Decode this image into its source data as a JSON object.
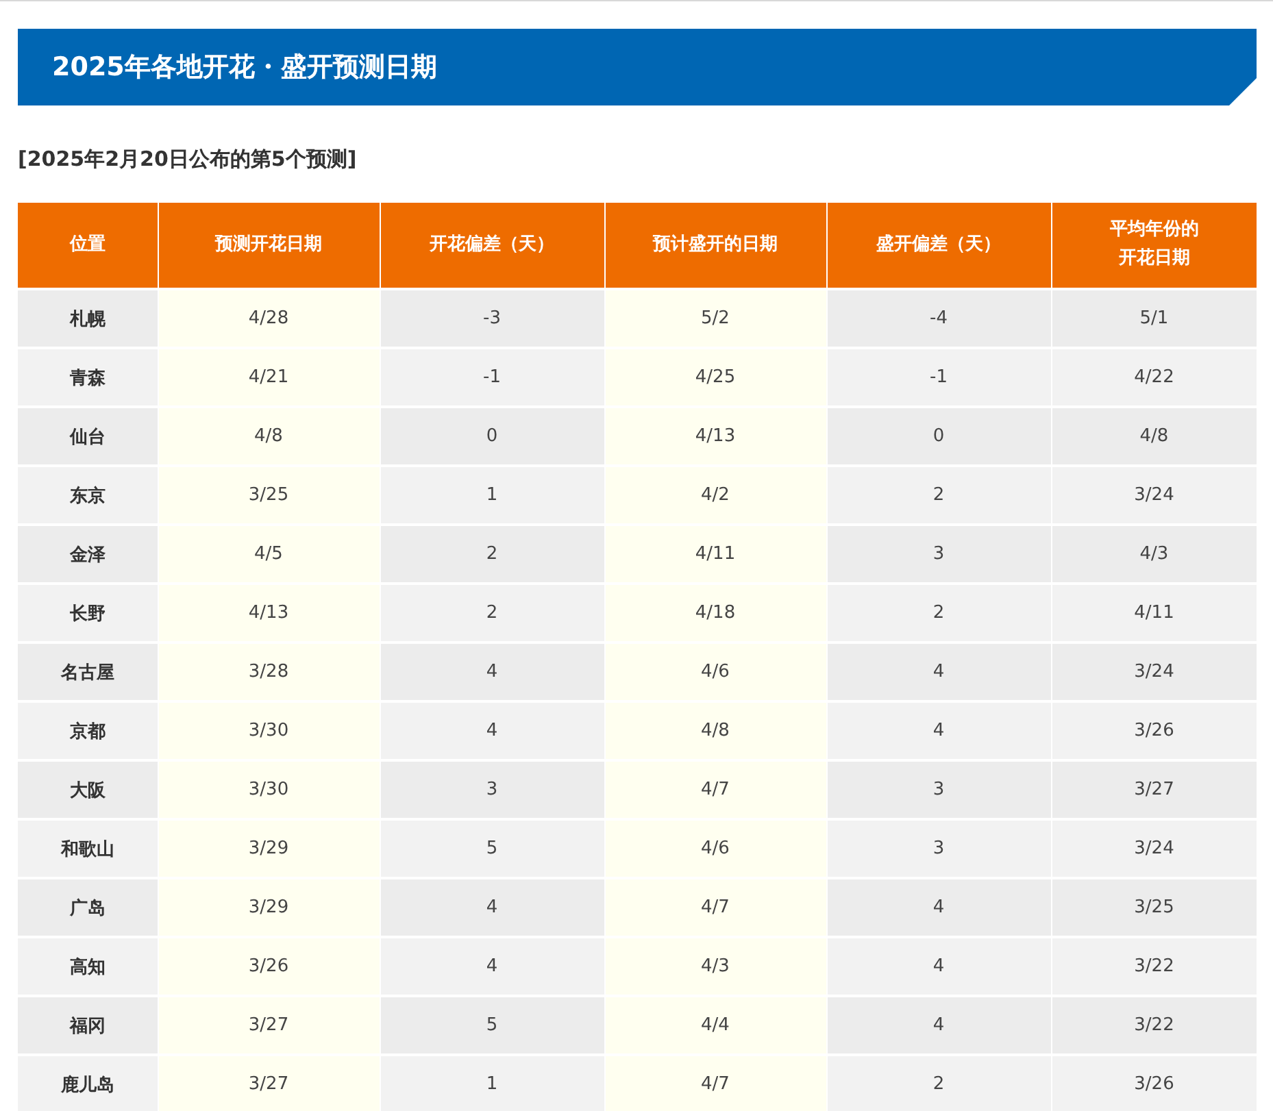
{
  "banner": {
    "title": "2025年各地开花・盛开预测日期"
  },
  "subtitle": "[2025年2月20日公布的第5个预测]",
  "table": {
    "columns": [
      "位置",
      "预测开花日期",
      "开花偏差（天）",
      "预计盛开的日期",
      "盛开偏差（天）",
      "平均年份的开花日期"
    ],
    "rows": [
      [
        "札幌",
        "4/28",
        "-3",
        "5/2",
        "-4",
        "5/1"
      ],
      [
        "青森",
        "4/21",
        "-1",
        "4/25",
        "-1",
        "4/22"
      ],
      [
        "仙台",
        "4/8",
        "0",
        "4/13",
        "0",
        "4/8"
      ],
      [
        "东京",
        "3/25",
        "1",
        "4/2",
        "2",
        "3/24"
      ],
      [
        "金泽",
        "4/5",
        "2",
        "4/11",
        "3",
        "4/3"
      ],
      [
        "长野",
        "4/13",
        "2",
        "4/18",
        "2",
        "4/11"
      ],
      [
        "名古屋",
        "3/28",
        "4",
        "4/6",
        "4",
        "3/24"
      ],
      [
        "京都",
        "3/30",
        "4",
        "4/8",
        "4",
        "3/26"
      ],
      [
        "大阪",
        "3/30",
        "3",
        "4/7",
        "3",
        "3/27"
      ],
      [
        "和歌山",
        "3/29",
        "5",
        "4/6",
        "3",
        "3/24"
      ],
      [
        "广岛",
        "3/29",
        "4",
        "4/7",
        "4",
        "3/25"
      ],
      [
        "高知",
        "3/26",
        "4",
        "4/3",
        "4",
        "3/22"
      ],
      [
        "福冈",
        "3/27",
        "5",
        "4/4",
        "4",
        "3/22"
      ],
      [
        "鹿儿岛",
        "3/27",
        "1",
        "4/7",
        "2",
        "3/26"
      ]
    ]
  }
}
